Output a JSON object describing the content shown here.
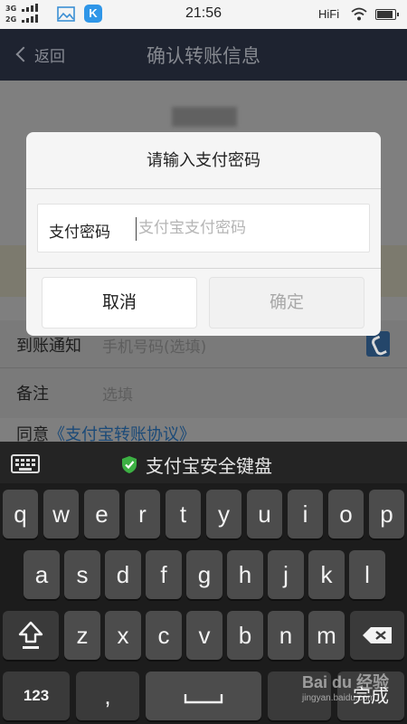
{
  "status_bar": {
    "network_top": "3G",
    "network_bottom": "2G",
    "time": "21:56",
    "hifi": "HiFi",
    "app_icon_letter": "K"
  },
  "nav": {
    "back_label": "返回",
    "title": "确认转账信息"
  },
  "form": {
    "rows": [
      {
        "label": "到账通知",
        "placeholder": "手机号码(选填)"
      },
      {
        "label": "备注",
        "placeholder": "选填"
      }
    ],
    "agreement_prefix": "同意",
    "agreement_link": "《支付宝转账协议》"
  },
  "dialog": {
    "title": "请输入支付密码",
    "field_label": "支付密码",
    "field_placeholder": "支付宝支付密码",
    "cancel_label": "取消",
    "confirm_label": "确定"
  },
  "keyboard": {
    "title": "支付宝安全键盘",
    "row1": [
      "q",
      "w",
      "e",
      "r",
      "t",
      "y",
      "u",
      "i",
      "o",
      "p"
    ],
    "row2": [
      "a",
      "s",
      "d",
      "f",
      "g",
      "h",
      "j",
      "k",
      "l"
    ],
    "row3": [
      "z",
      "x",
      "c",
      "v",
      "b",
      "n",
      "m"
    ],
    "numbers_label": "123",
    "comma_label": ",",
    "done_label": "完成"
  },
  "watermark": {
    "brand": "Bai du 经验",
    "url": "jingyan.baidu.com"
  },
  "colors": {
    "nav_bg": "#1e2330",
    "keyboard_bg": "#1c1c1c",
    "shield_green": "#3cb043",
    "link_blue": "#1b4a78"
  }
}
